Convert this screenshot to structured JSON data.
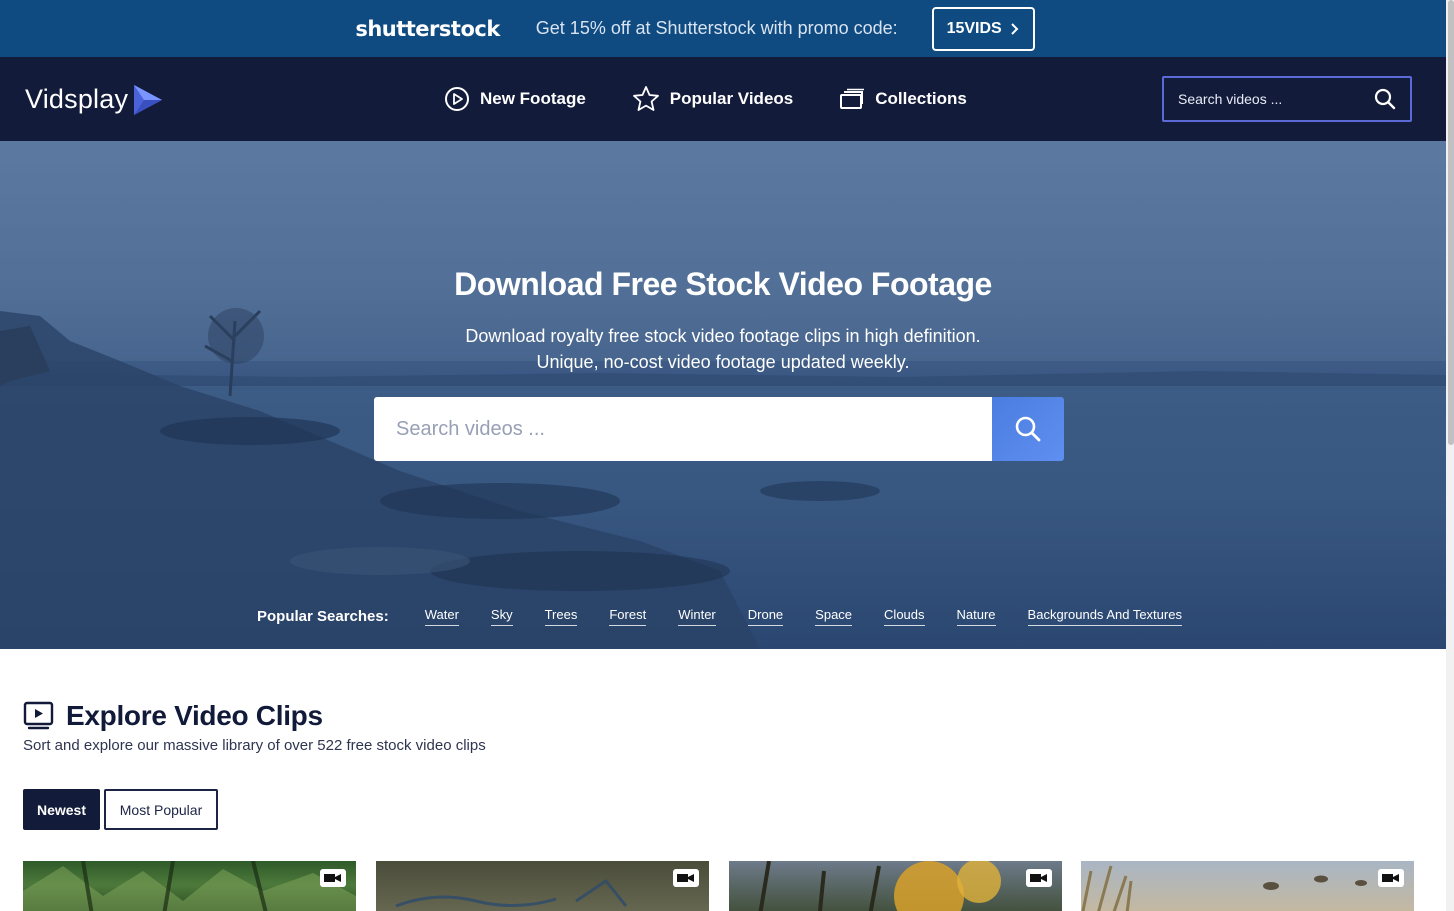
{
  "promo": {
    "brand": "shutterstock",
    "text": "Get 15% off at Shutterstock with promo code:",
    "code": "15VIDS"
  },
  "header": {
    "logo": "Vidsplay",
    "nav": [
      {
        "label": "New Footage",
        "icon": "play-circle-icon"
      },
      {
        "label": "Popular Videos",
        "icon": "star-icon"
      },
      {
        "label": "Collections",
        "icon": "collections-icon"
      }
    ],
    "search_placeholder": "Search videos ..."
  },
  "hero": {
    "title": "Download Free Stock Video Footage",
    "subtitle_line1": "Download royalty free stock video footage clips in high definition.",
    "subtitle_line2": "Unique, no-cost video footage updated weekly.",
    "search_placeholder": "Search videos ...",
    "popular_label": "Popular Searches:",
    "popular": [
      "Water",
      "Sky",
      "Trees",
      "Forest",
      "Winter",
      "Drone",
      "Space",
      "Clouds",
      "Nature",
      "Backgrounds And Textures"
    ]
  },
  "explore": {
    "title": "Explore Video Clips",
    "subtitle": "Sort and explore our massive library of over 522 free stock video clips",
    "sort": [
      "Newest",
      "Most Popular"
    ]
  },
  "colors": {
    "promo_bg": "#0f4a80",
    "header_bg": "#131b3a",
    "accent": "#5b8af0",
    "logo_tri": "#5b7ff2"
  }
}
